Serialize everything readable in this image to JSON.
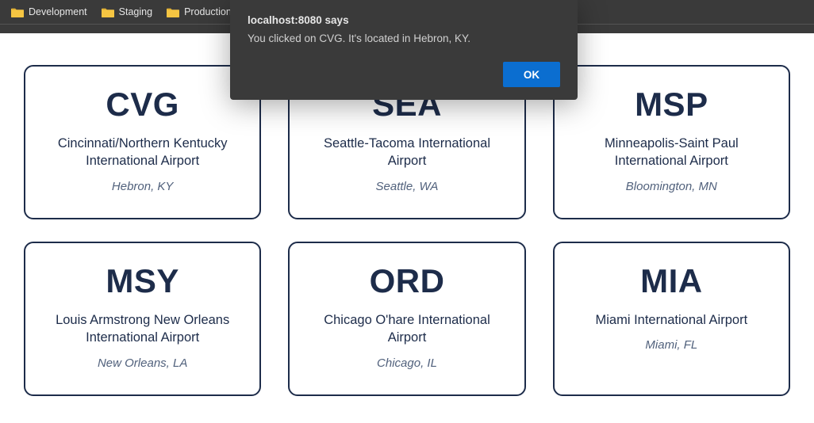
{
  "bookmarks": [
    {
      "label": "Development"
    },
    {
      "label": "Staging"
    },
    {
      "label": "Production"
    }
  ],
  "dialog": {
    "origin": "localhost:8080 says",
    "message": "You clicked on CVG. It's located in Hebron, KY.",
    "ok_label": "OK"
  },
  "airports": [
    {
      "code": "CVG",
      "name": "Cincinnati/Northern Kentucky International Airport",
      "location": "Hebron, KY"
    },
    {
      "code": "SEA",
      "name": "Seattle-Tacoma International Airport",
      "location": "Seattle, WA"
    },
    {
      "code": "MSP",
      "name": "Minneapolis-Saint Paul International Airport",
      "location": "Bloomington, MN"
    },
    {
      "code": "MSY",
      "name": "Louis Armstrong New Orleans International Airport",
      "location": "New Orleans, LA"
    },
    {
      "code": "ORD",
      "name": "Chicago O'hare International Airport",
      "location": "Chicago, IL"
    },
    {
      "code": "MIA",
      "name": "Miami International Airport",
      "location": "Miami, FL"
    }
  ]
}
